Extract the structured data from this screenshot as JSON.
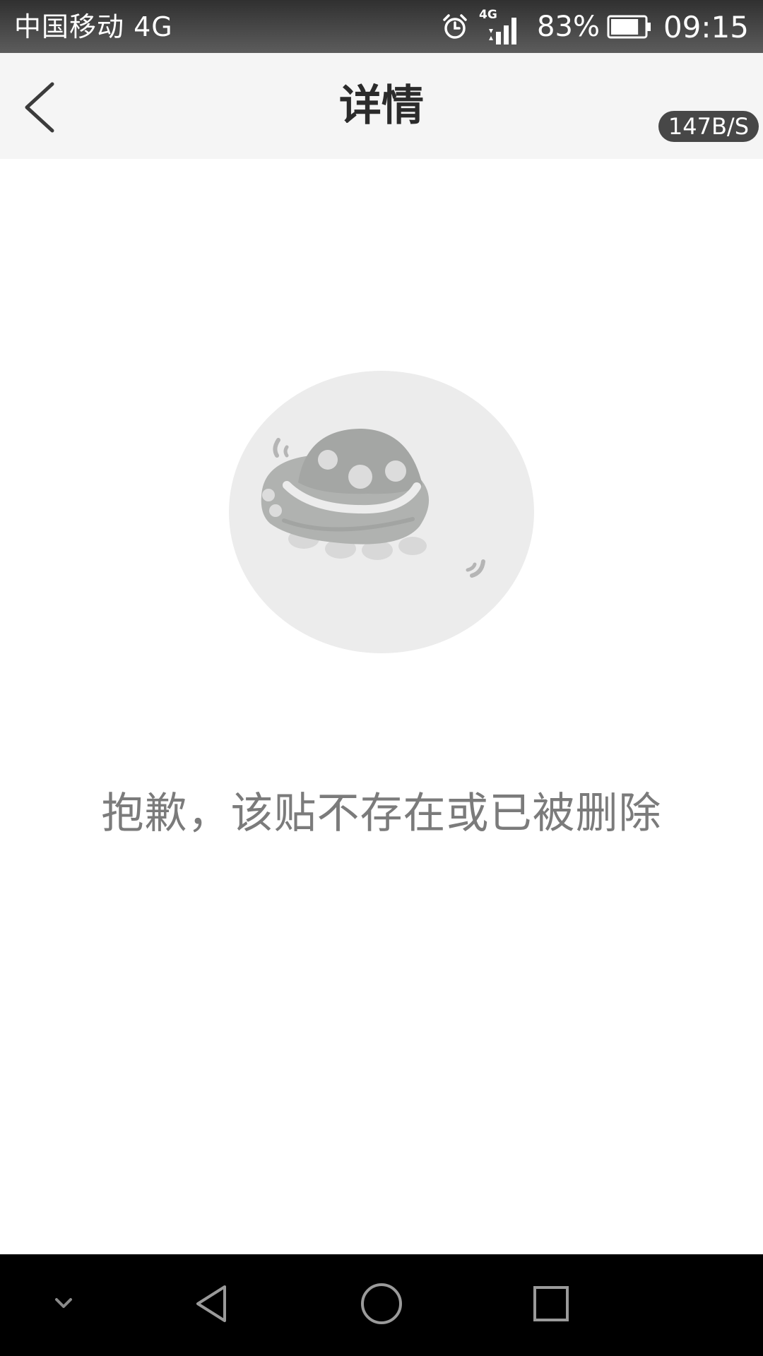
{
  "status_bar": {
    "carrier": "中国移动 4G",
    "network_badge": "4G",
    "battery_percent": "83%",
    "battery_level": 0.83,
    "time": "09:15",
    "icons": [
      "alarm-icon",
      "signal-icon",
      "battery-icon"
    ]
  },
  "header": {
    "title": "详情",
    "back_icon": "chevron-left-icon",
    "net_speed": "147B/S"
  },
  "empty_state": {
    "illustration": "ufo-icon",
    "message": "抱歉，该贴不存在或已被删除"
  },
  "nav_bar": {
    "buttons": [
      "collapse-icon",
      "back-triangle-icon",
      "home-circle-icon",
      "recents-square-icon"
    ]
  },
  "colors": {
    "status_bar": "#3a3a3a",
    "header_bg": "#f5f5f5",
    "title": "#2b2b2b",
    "message": "#7b7b7b",
    "illustration_circle": "#ececec",
    "ufo": "#b0b2b0",
    "nav_bar": "#000000"
  }
}
